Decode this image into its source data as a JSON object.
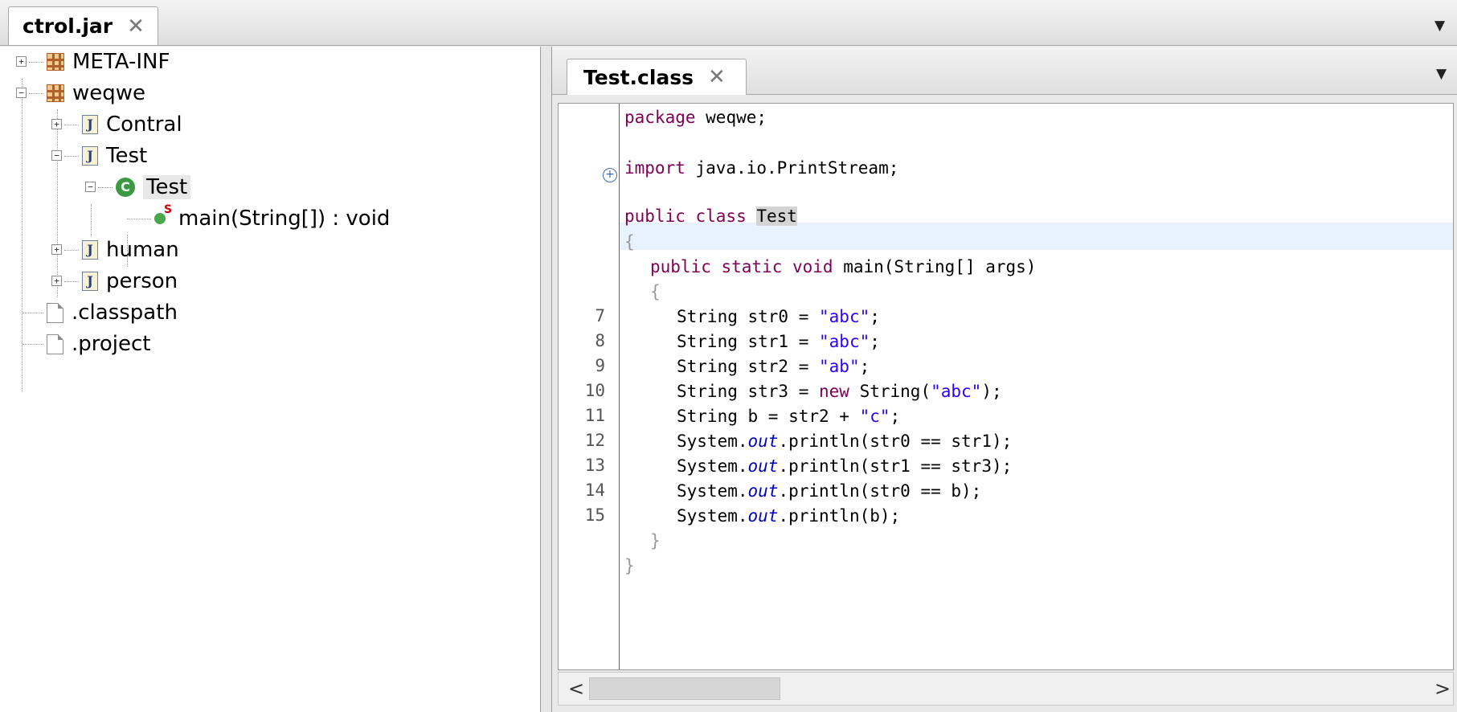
{
  "outer_tab": {
    "label": "ctrol.jar",
    "close": "✕",
    "menu": "▼"
  },
  "tree": {
    "nodes": [
      {
        "label": "META-INF",
        "icon": "package-icon",
        "expander": "+"
      },
      {
        "label": "weqwe",
        "icon": "package-icon",
        "expander": "−"
      },
      {
        "label": "Contral",
        "icon": "java-file-icon",
        "expander": "+"
      },
      {
        "label": "Test",
        "icon": "java-file-icon",
        "expander": "−"
      },
      {
        "label": "Test",
        "icon": "class-icon",
        "expander": "−"
      },
      {
        "label": "main(String[]) : void",
        "icon": "static-method-icon"
      },
      {
        "label": "human",
        "icon": "java-file-icon",
        "expander": "+"
      },
      {
        "label": "person",
        "icon": "java-file-icon",
        "expander": "+"
      },
      {
        "label": ".classpath",
        "icon": "file-icon"
      },
      {
        "label": ".project",
        "icon": "file-icon"
      }
    ],
    "java_badge": "J",
    "class_badge": "C",
    "static_badge": "S"
  },
  "editor": {
    "tab_label": "Test.class",
    "close": "✕",
    "menu": "▼",
    "fold_glyph": "+",
    "line_numbers": [
      "7",
      "8",
      "9",
      "10",
      "11",
      "12",
      "13",
      "14",
      "15"
    ],
    "scroll_left": "<",
    "scroll_right": ">"
  },
  "code": {
    "l1_kw": "package",
    "l1_rest": " weqwe;",
    "l3_kw": "import",
    "l3_rest": " java.io.PrintStream;",
    "l5_kw": "public class",
    "l5_sp": " ",
    "l5_name": "Test",
    "open_brace": "{",
    "close_brace": "}",
    "l7_kw": "public static void",
    "l7_rest": " main(String[] args)",
    "l9_a": "String str0 = ",
    "l9_s": "\"abc\"",
    "l10_a": "String str1 = ",
    "l10_s": "\"abc\"",
    "l11_a": "String str2 = ",
    "l11_s": "\"ab\"",
    "l12_a": "String str3 = ",
    "l12_kw": "new",
    "l12_b": " String(",
    "l12_s": "\"abc\"",
    "l12_c": ");",
    "l13_a": "String b = str2 + ",
    "l13_s": "\"c\"",
    "semi": ";",
    "sys": "System.",
    "out": "out",
    "l14_rest": ".println(str0 == str1);",
    "l15_rest": ".println(str1 == str3);",
    "l16_rest": ".println(str0 == b);",
    "l17_rest": ".println(b);"
  }
}
